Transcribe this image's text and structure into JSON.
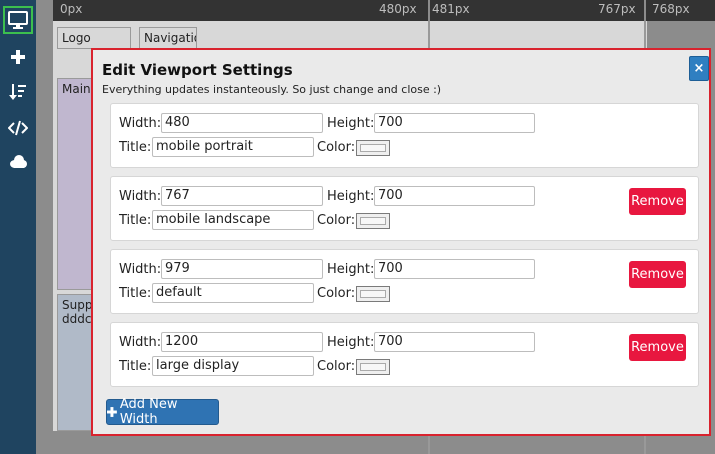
{
  "toolbar": {
    "buttons": [
      {
        "icon": "monitor-icon",
        "active": true
      },
      {
        "icon": "plus-icon"
      },
      {
        "icon": "sort-icon"
      },
      {
        "icon": "code-icon"
      },
      {
        "icon": "cloud-icon"
      }
    ],
    "active_color": "#3cbf4e"
  },
  "ruler": {
    "left_start": "0px",
    "left_end": "480px",
    "mid_start": "481px",
    "mid_end": "767px",
    "right_start": "768px"
  },
  "canvas": {
    "logo": "Logo",
    "navigation": "Navigation",
    "main": "Main c",
    "support_line1": "Supp",
    "support_line2": "dddc"
  },
  "modal": {
    "title": "Edit Viewport Settings",
    "subtitle": "Everything updates instanteously. So just change and close :)",
    "close_label": "×",
    "width_label": "Width:",
    "height_label": "Height:",
    "title_label": "Title:",
    "color_label": "Color:",
    "remove_label": "Remove",
    "add_label": "Add New Width",
    "viewports": [
      {
        "width": "480",
        "height": "700",
        "title": "mobile portrait",
        "removable": false
      },
      {
        "width": "767",
        "height": "700",
        "title": "mobile landscape",
        "removable": true
      },
      {
        "width": "979",
        "height": "700",
        "title": "default",
        "removable": true
      },
      {
        "width": "1200",
        "height": "700",
        "title": "large display",
        "removable": true
      }
    ]
  },
  "colors": {
    "toolbar_bg": "#1f4460",
    "modal_border": "#d9232e",
    "remove_bg": "#e8173f",
    "primary_bg": "#2f73b3"
  }
}
